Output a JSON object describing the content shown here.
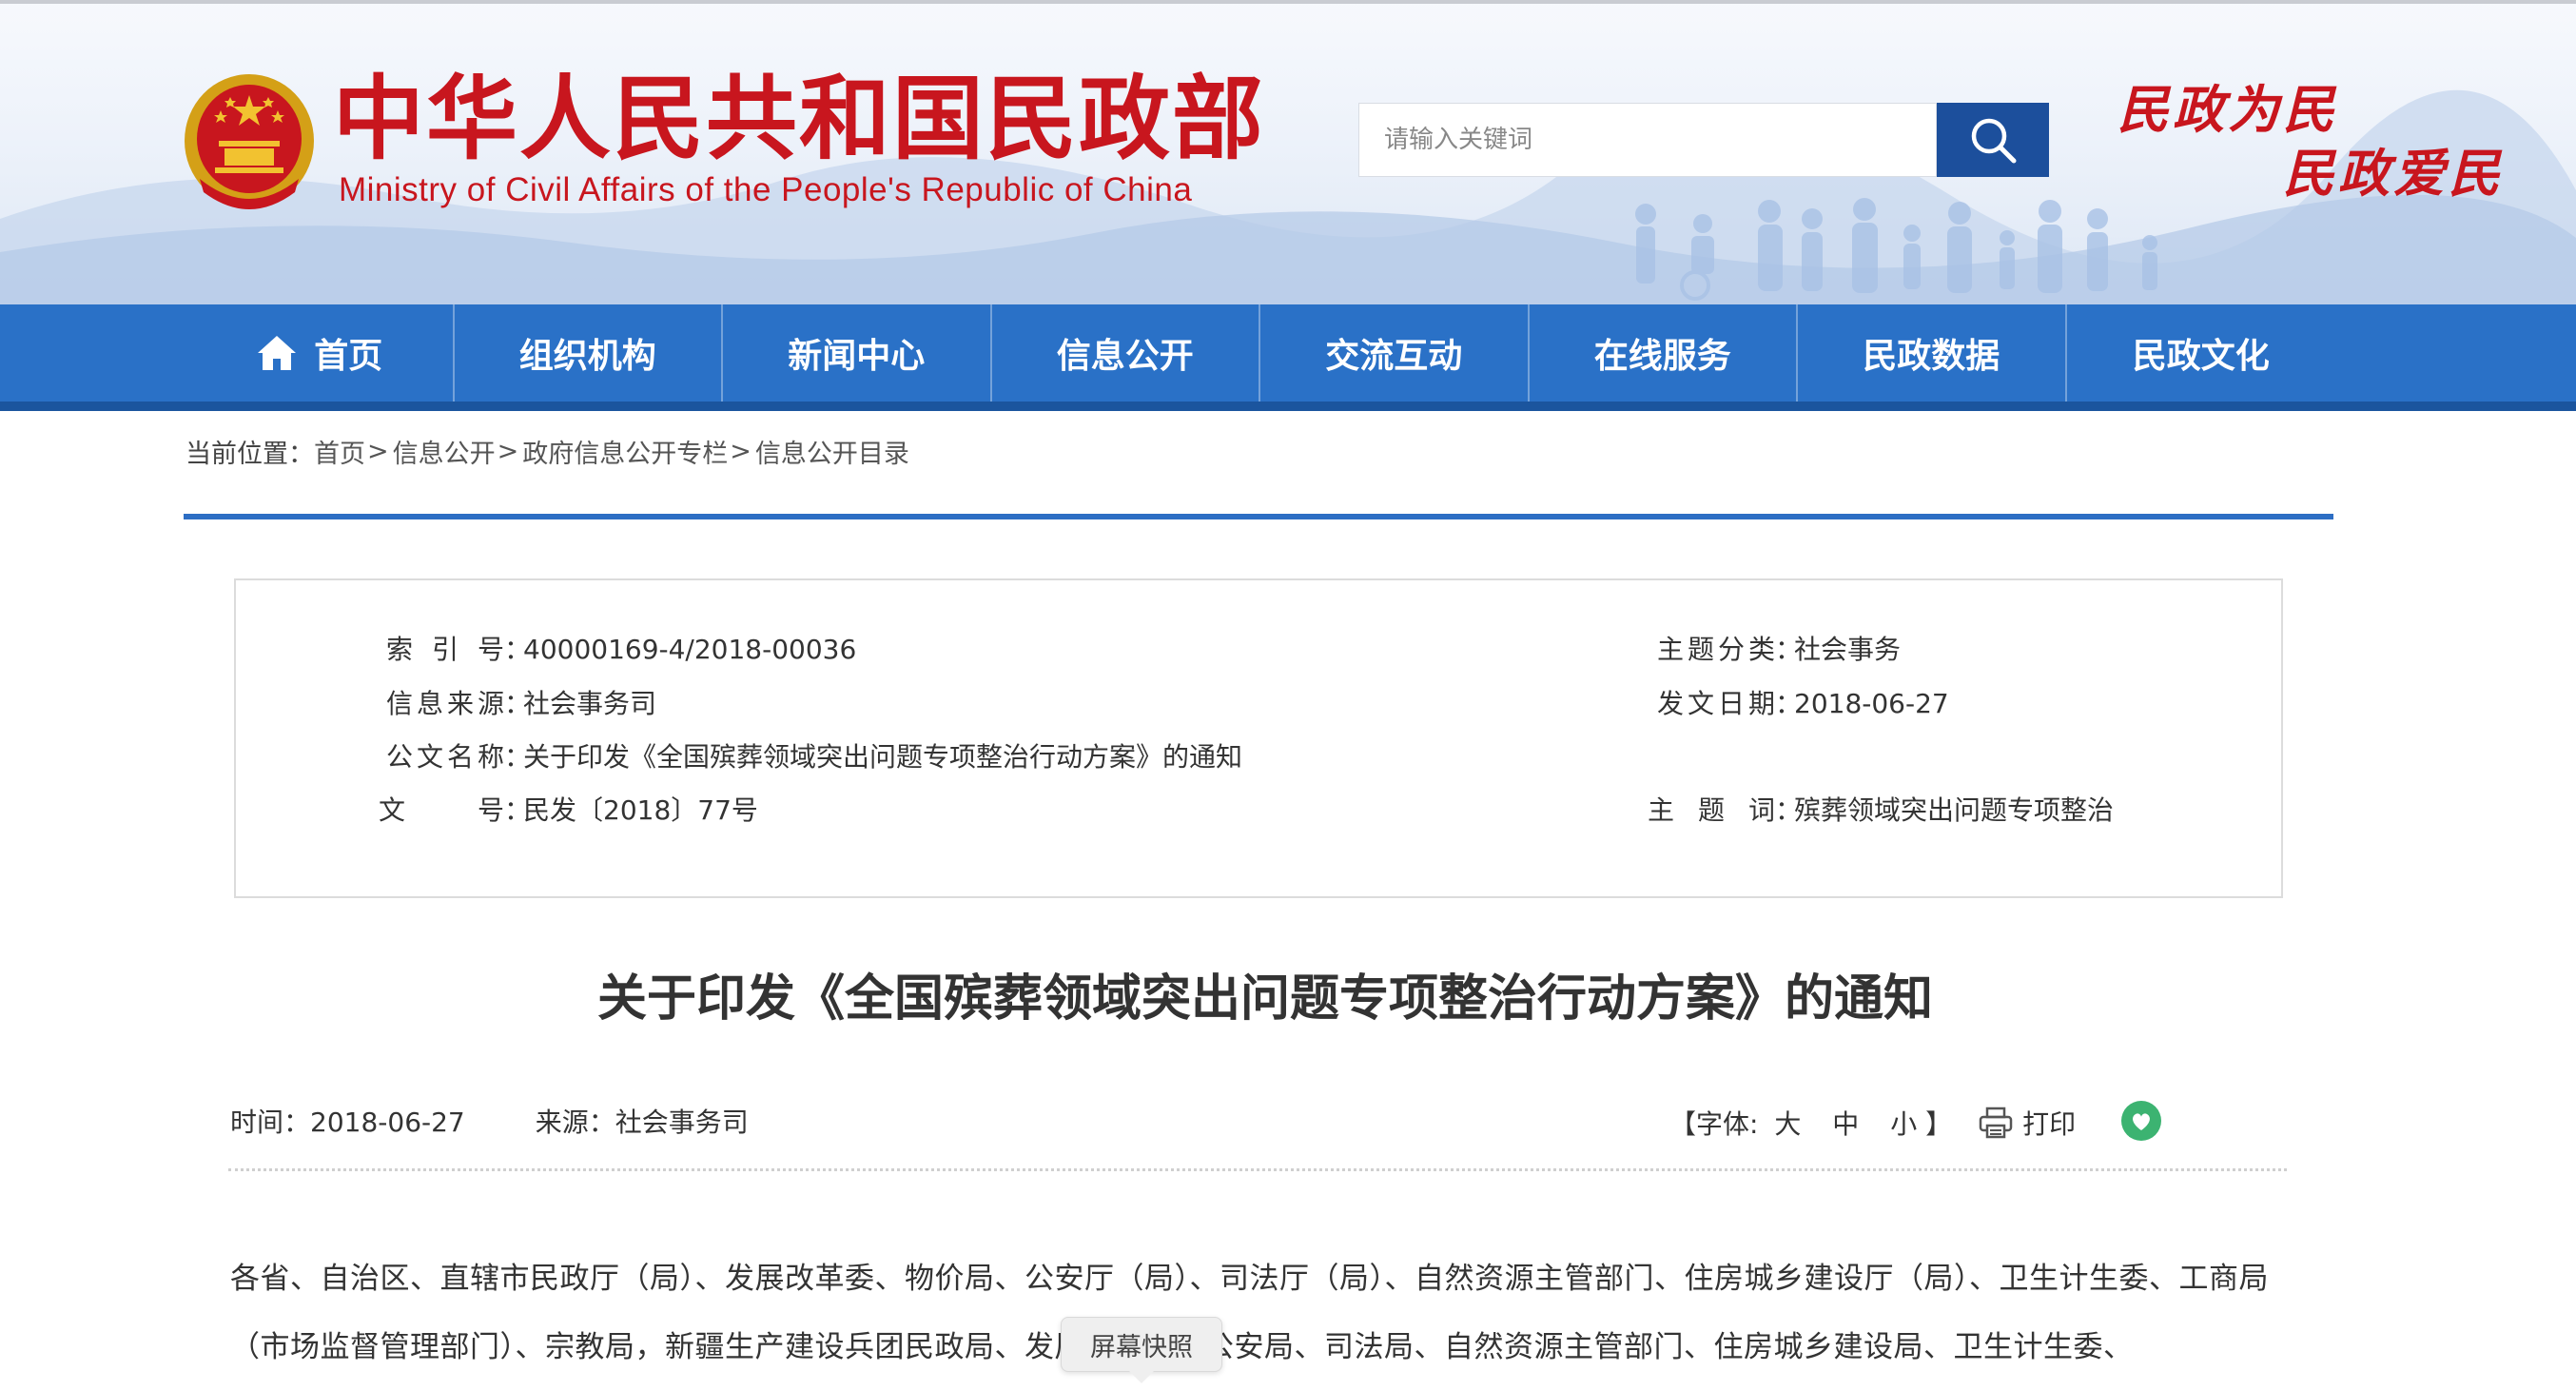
{
  "header": {
    "title_cn": "中华人民共和国民政部",
    "title_en": "Ministry of Civil Affairs of the People's Republic of China",
    "search_placeholder": "请输入关键词",
    "slogan_line1": "民政为民",
    "slogan_line2": "民政爱民"
  },
  "nav": {
    "items": [
      "首页",
      "组织机构",
      "新闻中心",
      "信息公开",
      "交流互动",
      "在线服务",
      "民政数据",
      "民政文化"
    ]
  },
  "breadcrumb": {
    "prefix": "当前位置：",
    "items": [
      "首页",
      "信息公开",
      "政府信息公开专栏",
      "信息公开目录"
    ],
    "separator": ">"
  },
  "meta": {
    "index_label": "索引号",
    "index_value": "40000169-4/2018-00036",
    "topic_label": "主题分类",
    "topic_value": "社会事务",
    "source_label": "信息来源",
    "source_value": "社会事务司",
    "date_label": "发文日期",
    "date_value": "2018-06-27",
    "doc_name_label": "公文名称",
    "doc_name_value": "关于印发《全国殡葬领域突出问题专项整治行动方案》的通知",
    "doc_no_label": "文号",
    "doc_no_value": "民发〔2018〕77号",
    "keyword_label": "主题词",
    "keyword_value": "殡葬领域突出问题专项整治",
    "colon": "："
  },
  "article": {
    "title": "关于印发《全国殡葬领域突出问题专项整治行动方案》的通知",
    "time_label": "时间：",
    "time_value": "2018-06-27",
    "source_label": "来源：",
    "source_value": "社会事务司",
    "font_label": "【字体:",
    "font_large": "大",
    "font_medium": "中",
    "font_small": "小",
    "font_end": "】",
    "print_label": "打印",
    "body": "各省、自治区、直辖市民政厅（局）、发展改革委、物价局、公安厅（局）、司法厅（局）、自然资源主管部门、住房城乡建设厅（局）、卫生计生委、工商局（市场监督管理部门）、宗教局，新疆生产建设兵团民政局、发展改革委、公安局、司法局、自然资源主管部门、住房城乡建设局、卫生计生委、"
  },
  "tooltip": {
    "label": "屏幕快照"
  },
  "colors": {
    "brand_red": "#c8161e",
    "nav_blue": "#2a71c7",
    "search_blue": "#1c4f9c",
    "rule_blue": "#2d6ec4",
    "wechat_green": "#3cb371"
  }
}
